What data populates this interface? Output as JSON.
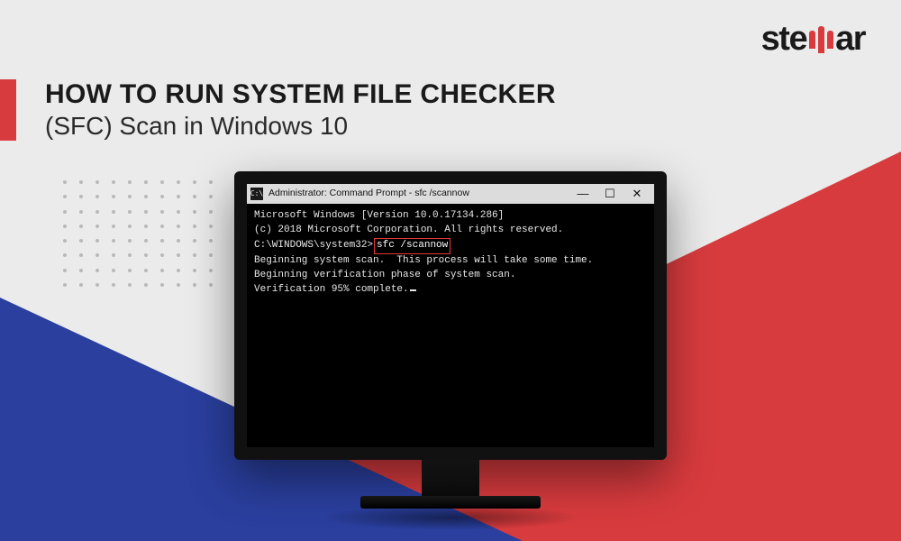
{
  "brand": {
    "name_pre": "ste",
    "name_post": "ar"
  },
  "title": {
    "line1": "HOW TO RUN SYSTEM FILE CHECKER",
    "line2": "(SFC) Scan in Windows 10"
  },
  "cmd": {
    "icon_glyph": "C:\\",
    "title": "Administrator: Command Prompt - sfc  /scannow",
    "controls": {
      "min": "—",
      "max": "☐",
      "close": "✕"
    },
    "lines": {
      "ver": "Microsoft Windows [Version 10.0.17134.286]",
      "copy": "(c) 2018 Microsoft Corporation. All rights reserved.",
      "blank": "",
      "prompt": "C:\\WINDOWS\\system32>",
      "command": "sfc /scannow",
      "begin": "Beginning system scan.  This process will take some time.",
      "verify1": "Beginning verification phase of system scan.",
      "verify2": "Verification 95% complete."
    }
  }
}
